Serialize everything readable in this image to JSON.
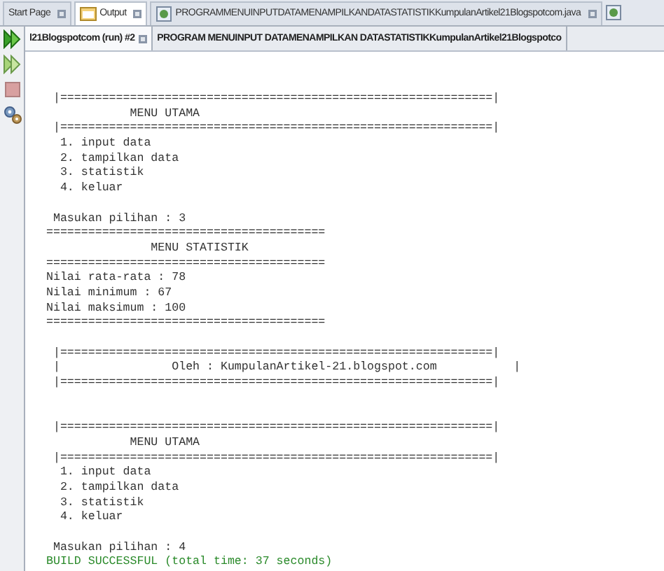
{
  "editor_tabs": [
    {
      "label": "Start Page",
      "selected": false,
      "kind": "page"
    },
    {
      "label": "Output",
      "selected": true,
      "kind": "output"
    },
    {
      "label": "PROGRAMMENUINPUTDATAMENAMPILKANDATASTATISTIKKumpulanArtikel21Blogspotcom.java",
      "selected": false,
      "kind": "java"
    }
  ],
  "output_tabs": [
    {
      "label": "l21Blogspotcom (run) #2",
      "selected": true
    },
    {
      "label": "PROGRAM MENUINPUT DATAMENAMPILKAN DATASTATISTIKKumpulanArtikel21Blogspotco",
      "selected": false
    }
  ],
  "console_lines": [
    {
      "kind": "output",
      "text": " |==============================================================|"
    },
    {
      "kind": "output",
      "text": "            MENU UTAMA"
    },
    {
      "kind": "output",
      "text": " |==============================================================|"
    },
    {
      "kind": "output",
      "text": "  1. input data"
    },
    {
      "kind": "output",
      "text": "  2. tampilkan data"
    },
    {
      "kind": "output",
      "text": "  3. statistik"
    },
    {
      "kind": "output",
      "text": "  4. keluar"
    },
    {
      "kind": "blank"
    },
    {
      "kind": "output",
      "text": " Masukan pilihan : 3"
    },
    {
      "kind": "output",
      "text": "========================================"
    },
    {
      "kind": "output",
      "text": "               MENU STATISTIK"
    },
    {
      "kind": "output",
      "text": "========================================"
    },
    {
      "kind": "output",
      "text": "Nilai rata-rata : 78"
    },
    {
      "kind": "output",
      "text": "Nilai minimum : 67"
    },
    {
      "kind": "output",
      "text": "Nilai maksimum : 100"
    },
    {
      "kind": "output",
      "text": "========================================"
    },
    {
      "kind": "blank"
    },
    {
      "kind": "output",
      "text": " |==============================================================|"
    },
    {
      "kind": "output",
      "text": " |                Oleh : KumpulanArtikel-21.blogspot.com           |"
    },
    {
      "kind": "output",
      "text": " |==============================================================|"
    },
    {
      "kind": "blank"
    },
    {
      "kind": "blank"
    },
    {
      "kind": "output",
      "text": " |==============================================================|"
    },
    {
      "kind": "output",
      "text": "            MENU UTAMA"
    },
    {
      "kind": "output",
      "text": " |==============================================================|"
    },
    {
      "kind": "output",
      "text": "  1. input data"
    },
    {
      "kind": "output",
      "text": "  2. tampilkan data"
    },
    {
      "kind": "output",
      "text": "  3. statistik"
    },
    {
      "kind": "output",
      "text": "  4. keluar"
    },
    {
      "kind": "blank"
    },
    {
      "kind": "output",
      "text": " Masukan pilihan : 4"
    },
    {
      "kind": "success",
      "text": "BUILD SUCCESSFUL (total time: 37 seconds)"
    }
  ]
}
